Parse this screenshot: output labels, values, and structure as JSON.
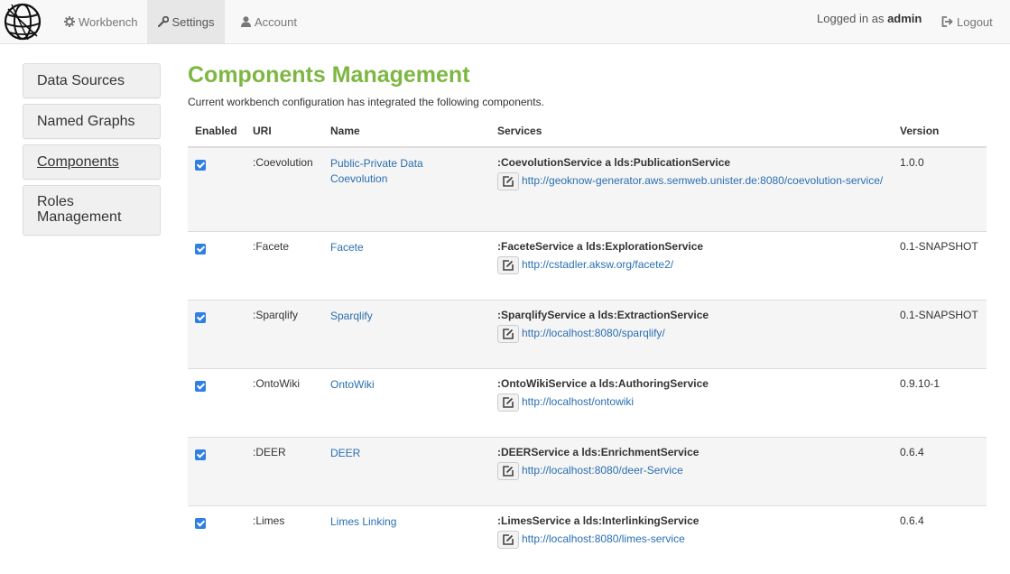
{
  "nav": {
    "workbench": "Workbench",
    "settings": "Settings",
    "account": "Account",
    "logged_in_prefix": "Logged in as",
    "user": "admin",
    "logout": "Logout"
  },
  "sidebar": {
    "items": [
      {
        "label": "Data Sources"
      },
      {
        "label": "Named Graphs"
      },
      {
        "label": "Components"
      },
      {
        "label": "Roles Management"
      }
    ]
  },
  "main": {
    "title": "Components Management",
    "subtitle": "Current workbench configuration has integrated the following components.",
    "columns": [
      "Enabled",
      "URI",
      "Name",
      "Services",
      "Version"
    ],
    "rows": [
      {
        "uri": ":Coevolution",
        "name": "Public-Private Data Coevolution",
        "service": ":CoevolutionService a lds:PublicationService",
        "url": "http://geoknow-generator.aws.semweb.unister.de:8080/coevolution-service/",
        "version": "1.0.0"
      },
      {
        "uri": ":Facete",
        "name": "Facete",
        "service": ":FaceteService a lds:ExplorationService",
        "url": "http://cstadler.aksw.org/facete2/",
        "version": "0.1-SNAPSHOT"
      },
      {
        "uri": ":Sparqlify",
        "name": "Sparqlify",
        "service": ":SparqlifyService a lds:ExtractionService",
        "url": "http://localhost:8080/sparqlify/",
        "version": "0.1-SNAPSHOT"
      },
      {
        "uri": ":OntoWiki",
        "name": "OntoWiki",
        "service": ":OntoWikiService a lds:AuthoringService",
        "url": "http://localhost/ontowiki",
        "version": "0.9.10-1"
      },
      {
        "uri": ":DEER",
        "name": "DEER",
        "service": ":DEERService a lds:EnrichmentService",
        "url": "http://localhost:8080/deer-Service",
        "version": "0.6.4"
      },
      {
        "uri": ":Limes",
        "name": "Limes Linking",
        "service": ":LimesService a lds:InterlinkingService",
        "url": "http://localhost:8080/limes-service",
        "version": "0.6.4"
      }
    ]
  },
  "colors": {
    "title_green": "#7db742",
    "link_blue": "#2a6fb0",
    "checkbox_blue": "#2f7fe5"
  }
}
